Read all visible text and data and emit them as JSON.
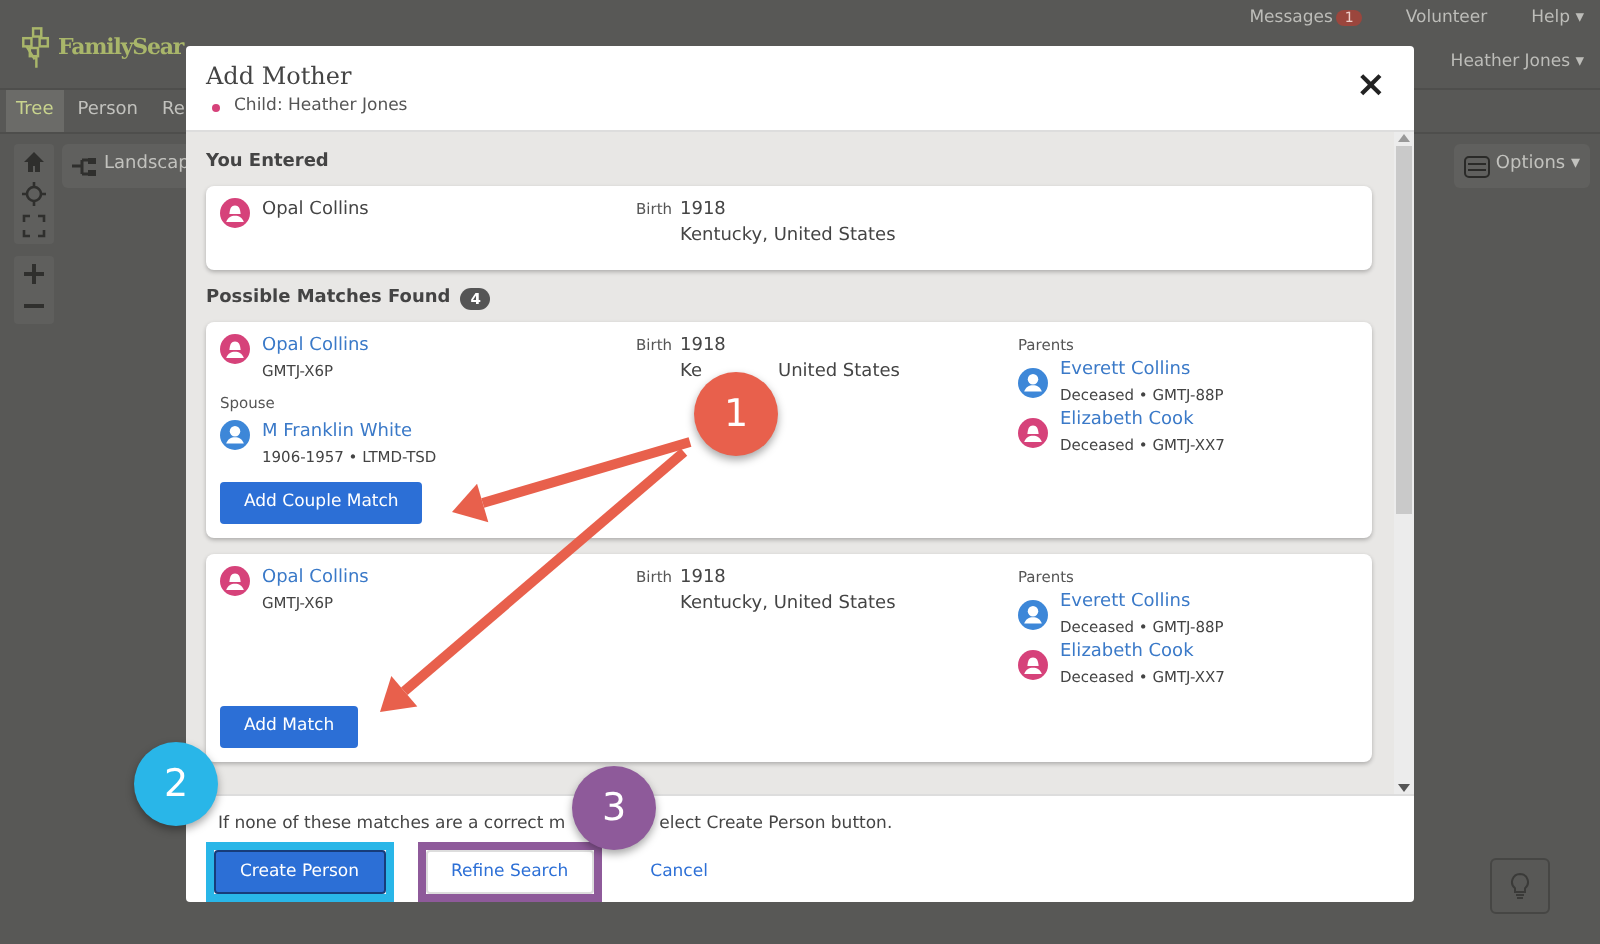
{
  "background": {
    "logo": "FamilySear",
    "top_links": [
      {
        "label": "Messages",
        "badge": "1"
      },
      {
        "label": "Volunteer"
      },
      {
        "label": "Help",
        "caret": "▾"
      }
    ],
    "user_menu": {
      "label": "Heather Jones",
      "caret": "▾"
    },
    "tabs": [
      {
        "label": "Tree",
        "selected": true
      },
      {
        "label": "Person",
        "selected": false
      },
      {
        "label": "Re",
        "selected": false
      }
    ],
    "view_button": "Landscap",
    "options_button": {
      "label": "Options",
      "caret": "▾"
    }
  },
  "dialog": {
    "title": "Add Mother",
    "subtitle": "Child: Heather Jones",
    "close": "×",
    "entered": {
      "heading": "You Entered",
      "name": "Opal Collins",
      "kind": "female",
      "birth_label": "Birth",
      "birth_year": "1918",
      "birth_place": [
        "Kentucky, United States"
      ]
    },
    "matches_heading": "Possible Matches Found",
    "matches_count": "4",
    "matches": [
      {
        "name": "Opal Collins",
        "kind": "female",
        "id": "GMTJ-X6P",
        "birth_label": "Birth",
        "birth_year": "1918",
        "birth_place": [
          "Ke",
          "United States"
        ],
        "spouse_label": "Spouse",
        "spouse": {
          "name": "M Franklin White",
          "kind": "male",
          "detail": "1906-1957 • LTMD-TSD"
        },
        "parents_label": "Parents",
        "parents": [
          {
            "name": "Everett Collins",
            "kind": "male",
            "detail": "Deceased • GMTJ-88P"
          },
          {
            "name": "Elizabeth Cook",
            "kind": "female",
            "detail": "Deceased • GMTJ-XX7"
          }
        ],
        "button": "Add Couple Match"
      },
      {
        "name": "Opal Collins",
        "kind": "female",
        "id": "GMTJ-X6P",
        "birth_label": "Birth",
        "birth_year": "1918",
        "birth_place": [
          "Kentucky, United States"
        ],
        "parents_label": "Parents",
        "parents": [
          {
            "name": "Everett Collins",
            "kind": "male",
            "detail": "Deceased • GMTJ-88P"
          },
          {
            "name": "Elizabeth Cook",
            "kind": "female",
            "detail": "Deceased • GMTJ-XX7"
          }
        ],
        "button": "Add Match"
      }
    ],
    "footer_note": [
      "If none of these matches are a correct m",
      "elect Create Person button."
    ],
    "buttons": [
      {
        "label": "Create Person",
        "kind": "primary",
        "color": "#29b6e8"
      },
      {
        "label": "Refine Search",
        "kind": "outline",
        "color": "#8e5a9a"
      },
      {
        "label": "Cancel",
        "kind": "link"
      }
    ]
  },
  "annotations": [
    {
      "number": "1",
      "color": "#e8604c"
    },
    {
      "number": "2",
      "color": "#29b6e8"
    },
    {
      "number": "3",
      "color": "#8e5a9a"
    }
  ]
}
